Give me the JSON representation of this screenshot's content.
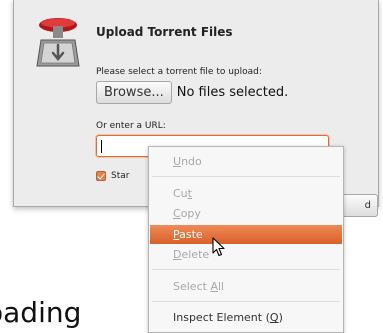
{
  "dialog": {
    "title": "Upload Torrent Files",
    "prompt": "Please select a torrent file to upload:",
    "browse_label": "Browse...",
    "no_files_text": "No files selected.",
    "url_label": "Or enter a URL:",
    "url_value": "",
    "start_label_partial": "Star",
    "start_checked": true,
    "partial_button_text": "d",
    "icon": "transmission-icon"
  },
  "background_text": "oading",
  "context_menu": {
    "items": [
      {
        "label": "Undo",
        "mnemonic_prefix": "",
        "mnemonic": "U",
        "mnemonic_suffix": "ndo",
        "enabled": false
      },
      {
        "label": "Cut",
        "mnemonic_prefix": "Cu",
        "mnemonic": "t",
        "mnemonic_suffix": "",
        "enabled": false
      },
      {
        "label": "Copy",
        "mnemonic_prefix": "",
        "mnemonic": "C",
        "mnemonic_suffix": "opy",
        "enabled": false
      },
      {
        "label": "Paste",
        "mnemonic_prefix": "",
        "mnemonic": "P",
        "mnemonic_suffix": "aste",
        "enabled": true,
        "highlighted": true
      },
      {
        "label": "Delete",
        "mnemonic_prefix": "",
        "mnemonic": "D",
        "mnemonic_suffix": "elete",
        "enabled": false
      },
      {
        "label": "Select All",
        "mnemonic_prefix": "Select ",
        "mnemonic": "A",
        "mnemonic_suffix": "ll",
        "enabled": false
      },
      {
        "label": "Inspect Element (Q)",
        "mnemonic_prefix": "Inspect Element (",
        "mnemonic": "Q",
        "mnemonic_suffix": ")",
        "enabled": true
      }
    ]
  },
  "colors": {
    "highlight": "#e3703a",
    "focus_border": "#e36d2e",
    "disabled_text": "#a8a8a8"
  }
}
